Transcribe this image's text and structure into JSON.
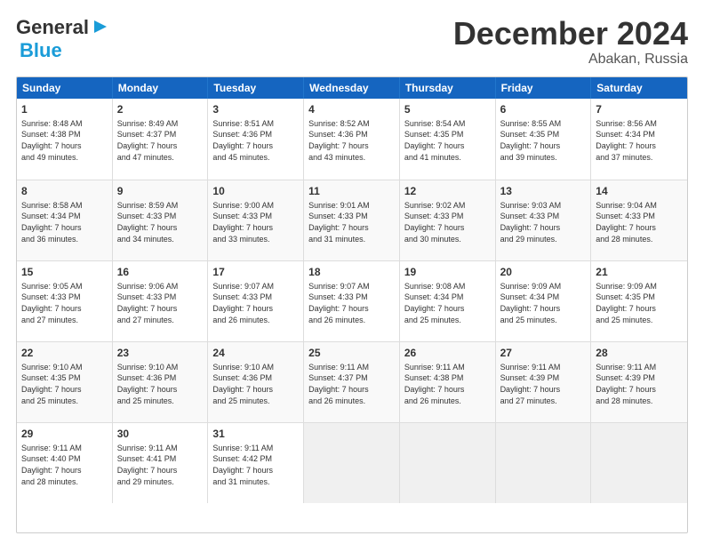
{
  "header": {
    "logo_general": "General",
    "logo_blue": "Blue",
    "month_title": "December 2024",
    "subtitle": "Abakan, Russia"
  },
  "weekdays": [
    "Sunday",
    "Monday",
    "Tuesday",
    "Wednesday",
    "Thursday",
    "Friday",
    "Saturday"
  ],
  "weeks": [
    [
      {
        "day": "1",
        "lines": [
          "Sunrise: 8:48 AM",
          "Sunset: 4:38 PM",
          "Daylight: 7 hours",
          "and 49 minutes."
        ]
      },
      {
        "day": "2",
        "lines": [
          "Sunrise: 8:49 AM",
          "Sunset: 4:37 PM",
          "Daylight: 7 hours",
          "and 47 minutes."
        ]
      },
      {
        "day": "3",
        "lines": [
          "Sunrise: 8:51 AM",
          "Sunset: 4:36 PM",
          "Daylight: 7 hours",
          "and 45 minutes."
        ]
      },
      {
        "day": "4",
        "lines": [
          "Sunrise: 8:52 AM",
          "Sunset: 4:36 PM",
          "Daylight: 7 hours",
          "and 43 minutes."
        ]
      },
      {
        "day": "5",
        "lines": [
          "Sunrise: 8:54 AM",
          "Sunset: 4:35 PM",
          "Daylight: 7 hours",
          "and 41 minutes."
        ]
      },
      {
        "day": "6",
        "lines": [
          "Sunrise: 8:55 AM",
          "Sunset: 4:35 PM",
          "Daylight: 7 hours",
          "and 39 minutes."
        ]
      },
      {
        "day": "7",
        "lines": [
          "Sunrise: 8:56 AM",
          "Sunset: 4:34 PM",
          "Daylight: 7 hours",
          "and 37 minutes."
        ]
      }
    ],
    [
      {
        "day": "8",
        "lines": [
          "Sunrise: 8:58 AM",
          "Sunset: 4:34 PM",
          "Daylight: 7 hours",
          "and 36 minutes."
        ]
      },
      {
        "day": "9",
        "lines": [
          "Sunrise: 8:59 AM",
          "Sunset: 4:33 PM",
          "Daylight: 7 hours",
          "and 34 minutes."
        ]
      },
      {
        "day": "10",
        "lines": [
          "Sunrise: 9:00 AM",
          "Sunset: 4:33 PM",
          "Daylight: 7 hours",
          "and 33 minutes."
        ]
      },
      {
        "day": "11",
        "lines": [
          "Sunrise: 9:01 AM",
          "Sunset: 4:33 PM",
          "Daylight: 7 hours",
          "and 31 minutes."
        ]
      },
      {
        "day": "12",
        "lines": [
          "Sunrise: 9:02 AM",
          "Sunset: 4:33 PM",
          "Daylight: 7 hours",
          "and 30 minutes."
        ]
      },
      {
        "day": "13",
        "lines": [
          "Sunrise: 9:03 AM",
          "Sunset: 4:33 PM",
          "Daylight: 7 hours",
          "and 29 minutes."
        ]
      },
      {
        "day": "14",
        "lines": [
          "Sunrise: 9:04 AM",
          "Sunset: 4:33 PM",
          "Daylight: 7 hours",
          "and 28 minutes."
        ]
      }
    ],
    [
      {
        "day": "15",
        "lines": [
          "Sunrise: 9:05 AM",
          "Sunset: 4:33 PM",
          "Daylight: 7 hours",
          "and 27 minutes."
        ]
      },
      {
        "day": "16",
        "lines": [
          "Sunrise: 9:06 AM",
          "Sunset: 4:33 PM",
          "Daylight: 7 hours",
          "and 27 minutes."
        ]
      },
      {
        "day": "17",
        "lines": [
          "Sunrise: 9:07 AM",
          "Sunset: 4:33 PM",
          "Daylight: 7 hours",
          "and 26 minutes."
        ]
      },
      {
        "day": "18",
        "lines": [
          "Sunrise: 9:07 AM",
          "Sunset: 4:33 PM",
          "Daylight: 7 hours",
          "and 26 minutes."
        ]
      },
      {
        "day": "19",
        "lines": [
          "Sunrise: 9:08 AM",
          "Sunset: 4:34 PM",
          "Daylight: 7 hours",
          "and 25 minutes."
        ]
      },
      {
        "day": "20",
        "lines": [
          "Sunrise: 9:09 AM",
          "Sunset: 4:34 PM",
          "Daylight: 7 hours",
          "and 25 minutes."
        ]
      },
      {
        "day": "21",
        "lines": [
          "Sunrise: 9:09 AM",
          "Sunset: 4:35 PM",
          "Daylight: 7 hours",
          "and 25 minutes."
        ]
      }
    ],
    [
      {
        "day": "22",
        "lines": [
          "Sunrise: 9:10 AM",
          "Sunset: 4:35 PM",
          "Daylight: 7 hours",
          "and 25 minutes."
        ]
      },
      {
        "day": "23",
        "lines": [
          "Sunrise: 9:10 AM",
          "Sunset: 4:36 PM",
          "Daylight: 7 hours",
          "and 25 minutes."
        ]
      },
      {
        "day": "24",
        "lines": [
          "Sunrise: 9:10 AM",
          "Sunset: 4:36 PM",
          "Daylight: 7 hours",
          "and 25 minutes."
        ]
      },
      {
        "day": "25",
        "lines": [
          "Sunrise: 9:11 AM",
          "Sunset: 4:37 PM",
          "Daylight: 7 hours",
          "and 26 minutes."
        ]
      },
      {
        "day": "26",
        "lines": [
          "Sunrise: 9:11 AM",
          "Sunset: 4:38 PM",
          "Daylight: 7 hours",
          "and 26 minutes."
        ]
      },
      {
        "day": "27",
        "lines": [
          "Sunrise: 9:11 AM",
          "Sunset: 4:39 PM",
          "Daylight: 7 hours",
          "and 27 minutes."
        ]
      },
      {
        "day": "28",
        "lines": [
          "Sunrise: 9:11 AM",
          "Sunset: 4:39 PM",
          "Daylight: 7 hours",
          "and 28 minutes."
        ]
      }
    ],
    [
      {
        "day": "29",
        "lines": [
          "Sunrise: 9:11 AM",
          "Sunset: 4:40 PM",
          "Daylight: 7 hours",
          "and 28 minutes."
        ]
      },
      {
        "day": "30",
        "lines": [
          "Sunrise: 9:11 AM",
          "Sunset: 4:41 PM",
          "Daylight: 7 hours",
          "and 29 minutes."
        ]
      },
      {
        "day": "31",
        "lines": [
          "Sunrise: 9:11 AM",
          "Sunset: 4:42 PM",
          "Daylight: 7 hours",
          "and 31 minutes."
        ]
      },
      {
        "day": "",
        "lines": []
      },
      {
        "day": "",
        "lines": []
      },
      {
        "day": "",
        "lines": []
      },
      {
        "day": "",
        "lines": []
      }
    ]
  ]
}
